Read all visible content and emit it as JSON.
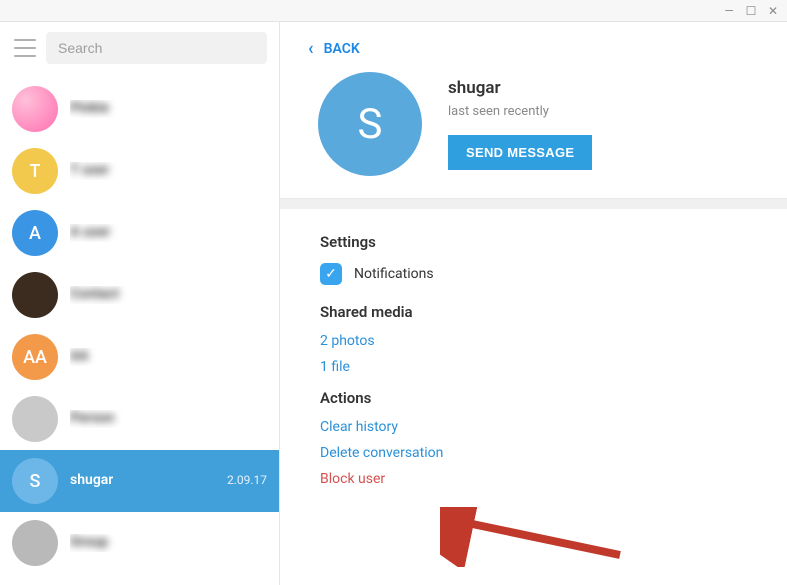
{
  "window": {
    "minimize": "—",
    "maximize": "☐",
    "close": "✕"
  },
  "search": {
    "placeholder": "Search"
  },
  "chats": [
    {
      "name": "Pinkie",
      "preview": " ",
      "time": " ",
      "avatar_class": "av-pink",
      "initial": "",
      "selected": false,
      "blur": true
    },
    {
      "name": "T user",
      "preview": " ",
      "time": " ",
      "avatar_class": "av-yellow",
      "initial": "T",
      "selected": false,
      "blur": true
    },
    {
      "name": "A user",
      "preview": " ",
      "time": " ",
      "avatar_class": "av-blue",
      "initial": "A",
      "selected": false,
      "blur": true
    },
    {
      "name": "Contact",
      "preview": " ",
      "time": " ",
      "avatar_class": "av-dark",
      "initial": "",
      "selected": false,
      "blur": true
    },
    {
      "name": "AA",
      "preview": " ",
      "time": " ",
      "avatar_class": "av-orange",
      "initial": "AA",
      "selected": false,
      "blur": true
    },
    {
      "name": "Person",
      "preview": " ",
      "time": " ",
      "avatar_class": "av-photo",
      "initial": "",
      "selected": false,
      "blur": true
    },
    {
      "name": "shugar",
      "preview": " ",
      "time": "2.09.17",
      "avatar_class": "av-lightblue",
      "initial": "S",
      "selected": true,
      "blur": false
    },
    {
      "name": "Group",
      "preview": " ",
      "time": " ",
      "avatar_class": "av-gray",
      "initial": "",
      "selected": false,
      "blur": true
    }
  ],
  "back_label": "BACK",
  "profile": {
    "initial": "S",
    "name": "shugar",
    "status": "last seen recently",
    "send_label": "SEND MESSAGE"
  },
  "settings": {
    "title": "Settings",
    "notifications_label": "Notifications"
  },
  "shared": {
    "title": "Shared media",
    "photos": "2 photos",
    "files": "1 file"
  },
  "actions": {
    "title": "Actions",
    "clear": "Clear history",
    "delete": "Delete conversation",
    "block": "Block user"
  }
}
